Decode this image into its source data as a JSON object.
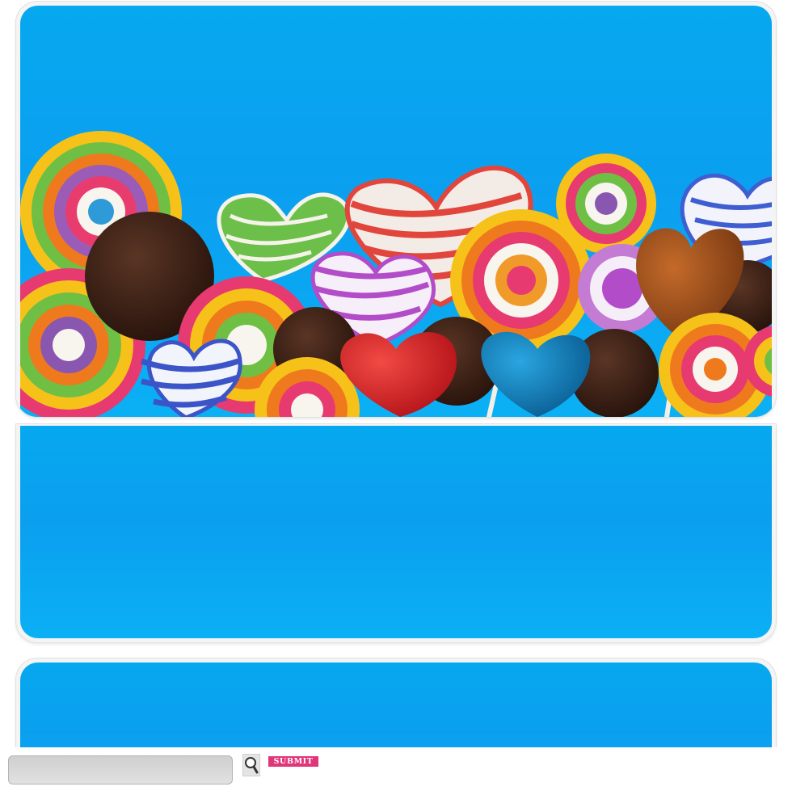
{
  "banner": {
    "image": "lollipop-assortment",
    "palette": {
      "sky": "#0aa6ef",
      "pink_accent": "#e0357a"
    }
  },
  "search": {
    "value": "",
    "placeholder": "",
    "search_icon": "magnifier-icon",
    "submit_label": "SUBMIT"
  }
}
